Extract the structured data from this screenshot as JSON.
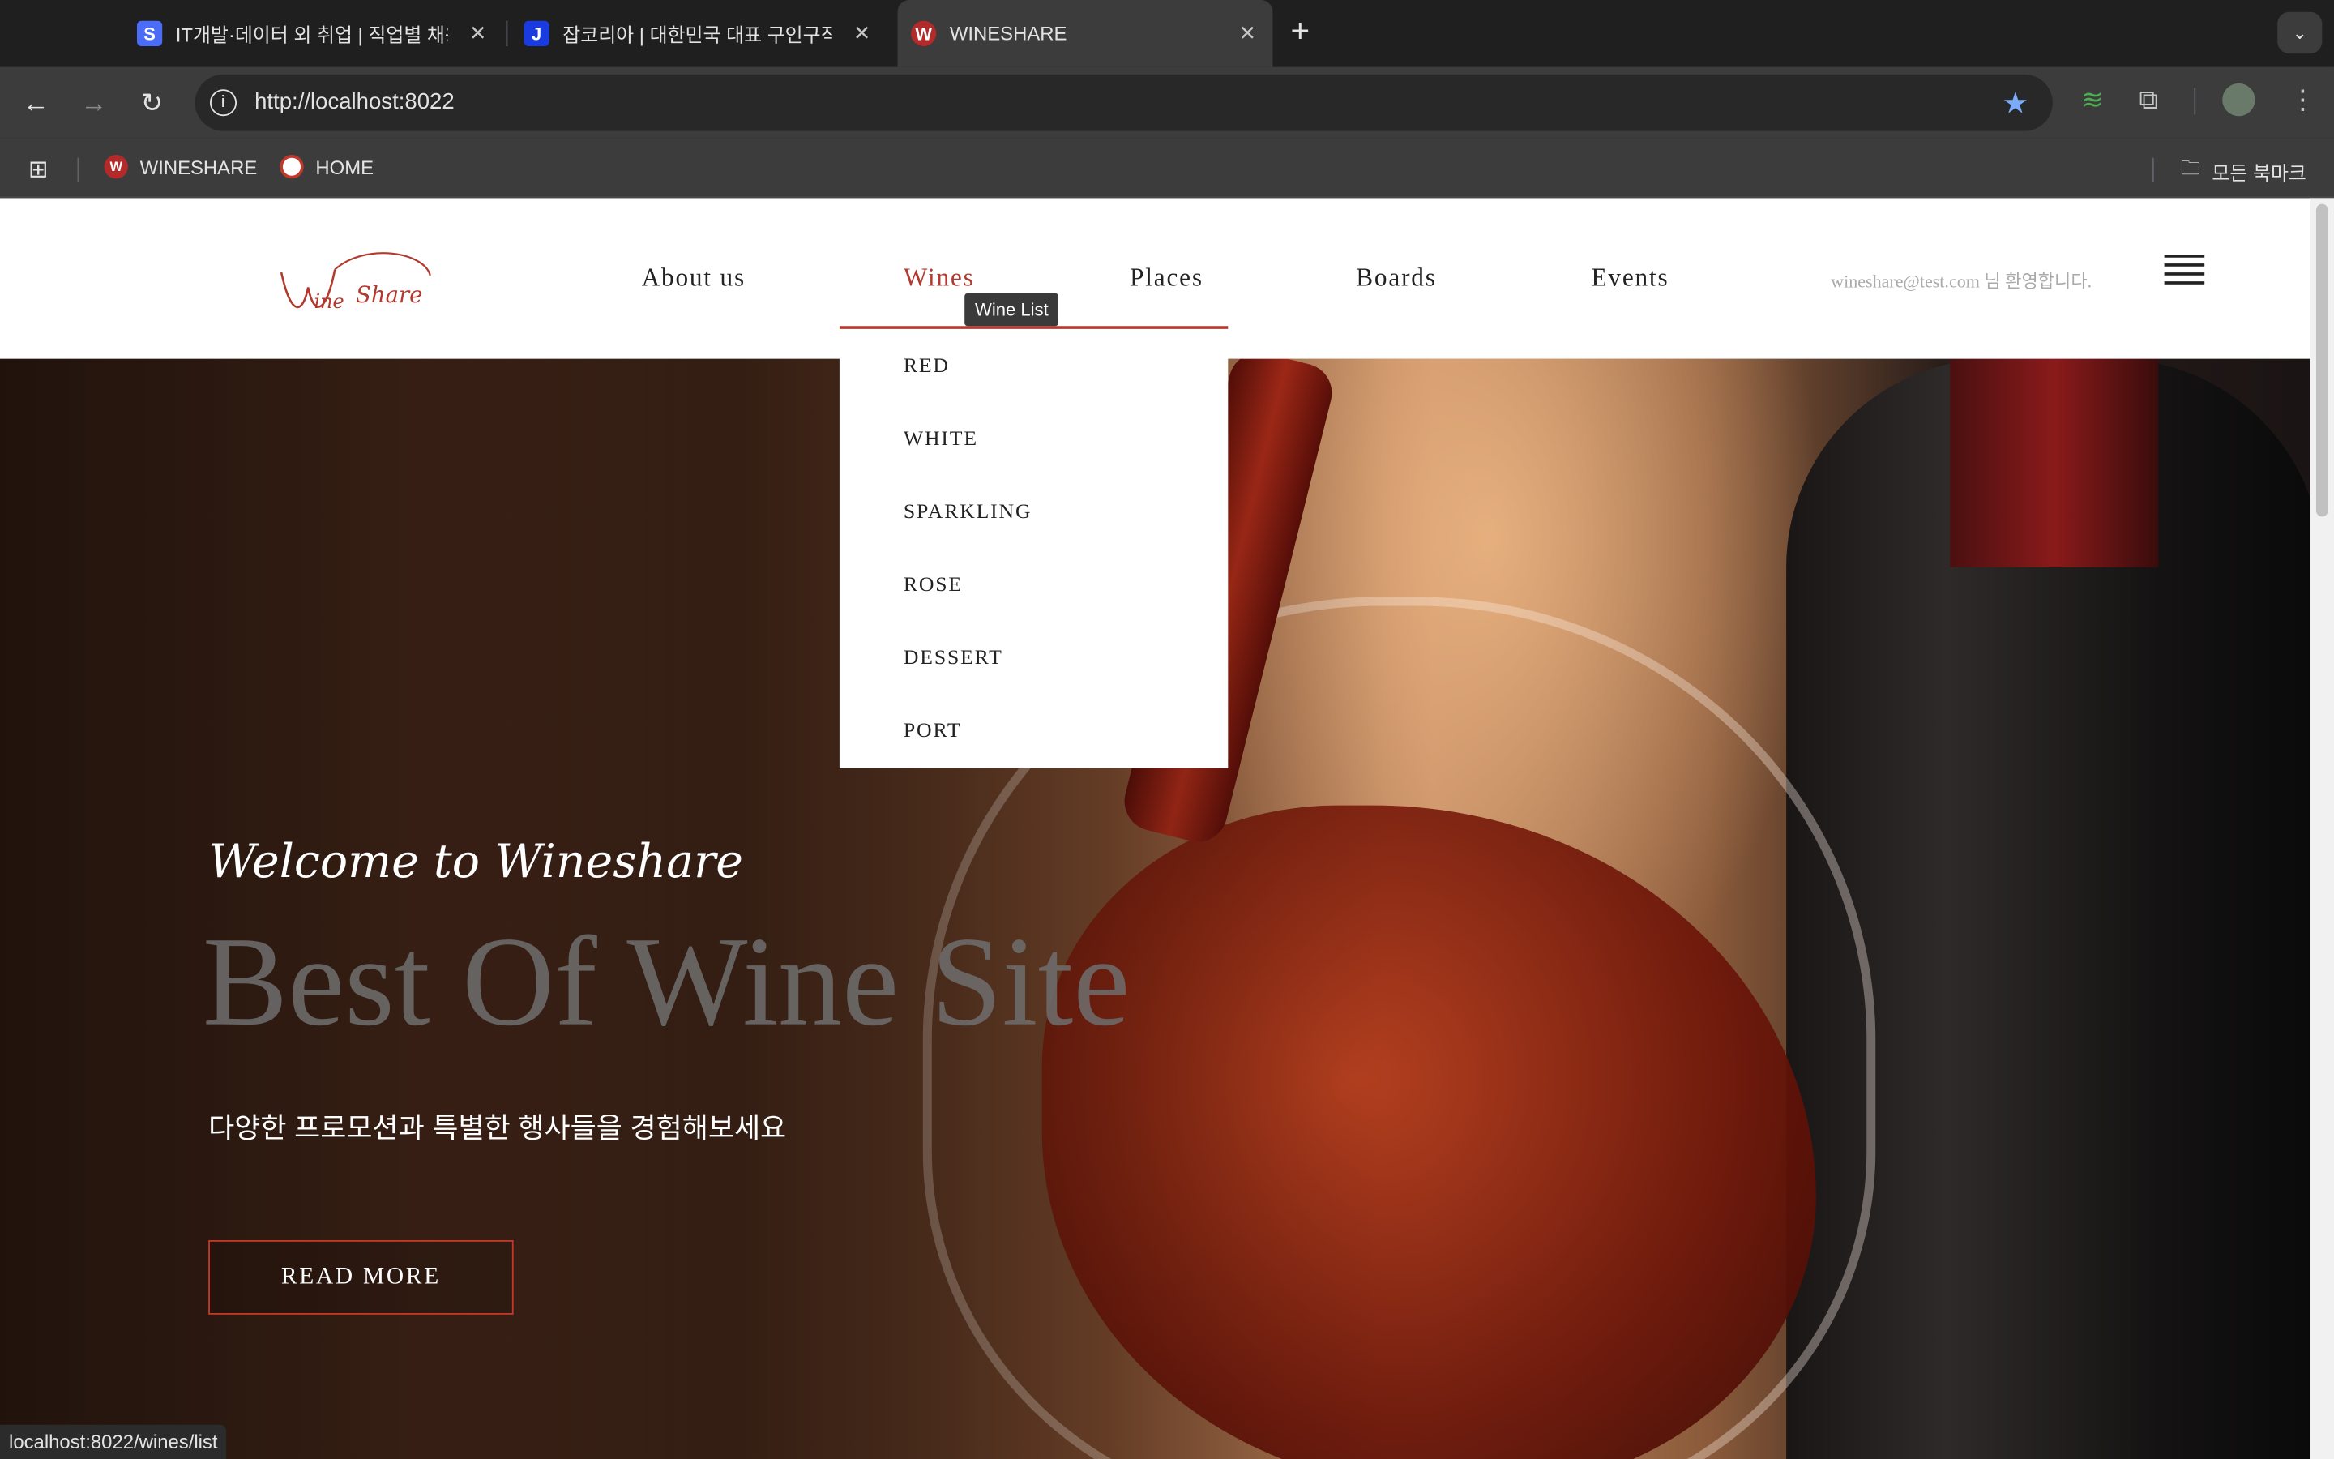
{
  "browser": {
    "tabs": [
      {
        "title": "IT개발·데이터 외 취업 | 직업별 채용",
        "favicon_letter": "S",
        "favicon_color": "#4a6cf7"
      },
      {
        "title": "잡코리아 | 대한민국 대표 구인구직",
        "favicon_letter": "J",
        "favicon_color": "#1a3be0"
      },
      {
        "title": "WINESHARE",
        "favicon_letter": "W",
        "favicon_color": "#b22a2a"
      }
    ],
    "url": "http://localhost:8022",
    "bookmarks": [
      {
        "label": "WINESHARE"
      },
      {
        "label": "HOME"
      }
    ],
    "all_bookmarks_label": "모든 북마크",
    "status_url": "localhost:8022/wines/list"
  },
  "site": {
    "logo_text": "Wine Share",
    "nav": [
      {
        "label": "About us"
      },
      {
        "label": "Wines"
      },
      {
        "label": "Places"
      },
      {
        "label": "Boards"
      },
      {
        "label": "Events"
      }
    ],
    "user_email": "wineshare@test.com",
    "user_greeting": "님 환영합니다.",
    "tooltip": "Wine List",
    "dropdown": [
      "RED",
      "WHITE",
      "SPARKLING",
      "ROSE",
      "DESSERT",
      "PORT"
    ],
    "hero": {
      "welcome": "Welcome to Wineshare",
      "headline": "Best Of Wine Site",
      "subtitle": "다양한 프로모션과 특별한 행사들을 경험해보세요",
      "button": "READ MORE"
    }
  },
  "colors": {
    "accent": "#b23a2e",
    "chrome_dark": "#1f1f1f",
    "chrome_toolbar": "#3c3c3c"
  }
}
